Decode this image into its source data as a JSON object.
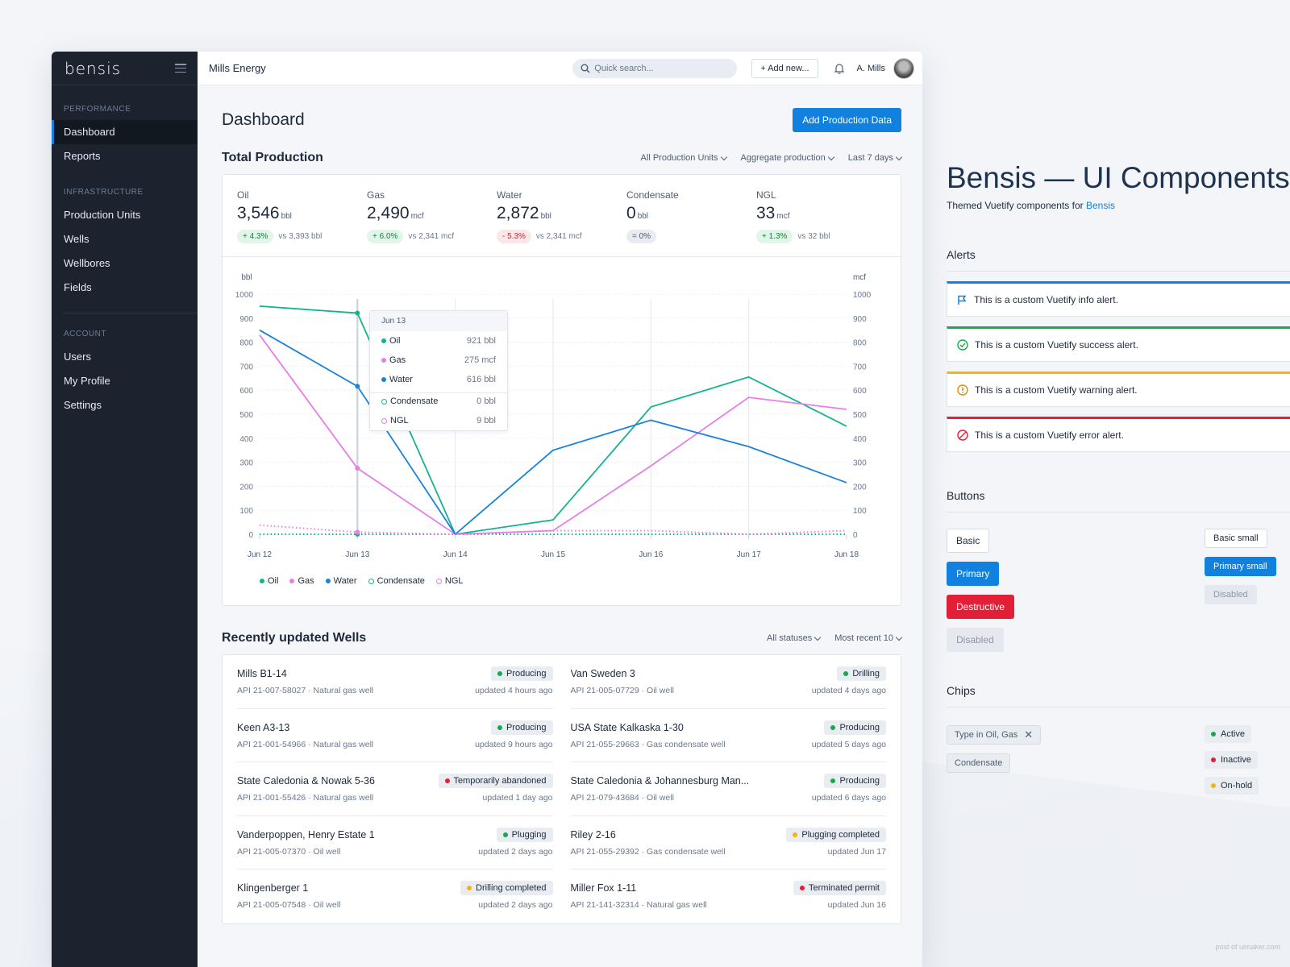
{
  "app": {
    "logo": "bensis",
    "org": "Mills Energy",
    "search_placeholder": "Quick search...",
    "add_new_label": "+ Add new...",
    "user_name": "A. Mills"
  },
  "sidebar": {
    "sections": [
      {
        "heading": "PERFORMANCE",
        "items": [
          {
            "label": "Dashboard",
            "active": true
          },
          {
            "label": "Reports"
          }
        ]
      },
      {
        "heading": "INFRASTRUCTURE",
        "items": [
          {
            "label": "Production Units"
          },
          {
            "label": "Wells"
          },
          {
            "label": "Wellbores"
          },
          {
            "label": "Fields"
          }
        ]
      },
      {
        "heading": "ACCOUNT",
        "items": [
          {
            "label": "Users"
          },
          {
            "label": "My Profile"
          },
          {
            "label": "Settings"
          }
        ]
      }
    ]
  },
  "page": {
    "title": "Dashboard",
    "primary_action": "Add Production Data"
  },
  "production": {
    "title": "Total Production",
    "filters": [
      "All Production Units",
      "Aggregate production",
      "Last 7 days"
    ],
    "stats": [
      {
        "label": "Oil",
        "value": "3,546",
        "unit": "bbl",
        "change": "+ 4.3%",
        "trend": "up",
        "compare": "vs 3,393 bbl"
      },
      {
        "label": "Gas",
        "value": "2,490",
        "unit": "mcf",
        "change": "+ 6.0%",
        "trend": "up",
        "compare": "vs 2,341 mcf"
      },
      {
        "label": "Water",
        "value": "2,872",
        "unit": "bbl",
        "change": "- 5.3%",
        "trend": "down",
        "compare": "vs 2,341 mcf"
      },
      {
        "label": "Condensate",
        "value": "0",
        "unit": "bbl",
        "change": "= 0%",
        "trend": "eq",
        "compare": ""
      },
      {
        "label": "NGL",
        "value": "33",
        "unit": "mcf",
        "change": "+ 1.3%",
        "trend": "up",
        "compare": "vs 32 bbl"
      }
    ],
    "tooltip": {
      "date": "Jun 13",
      "rows": [
        {
          "name": "Oil",
          "value": "921 bbl",
          "color": "#14b38f",
          "hollow": false
        },
        {
          "name": "Gas",
          "value": "275 mcf",
          "color": "#e67ee8",
          "hollow": false
        },
        {
          "name": "Water",
          "value": "616 bbl",
          "color": "#1a82d9",
          "hollow": false
        },
        {
          "name": "Condensate",
          "value": "0 bbl",
          "color": "#14b38f",
          "hollow": true
        },
        {
          "name": "NGL",
          "value": "9 bbl",
          "color": "#e67ee8",
          "hollow": true
        }
      ]
    }
  },
  "chart_data": {
    "type": "line",
    "title": "",
    "x": [
      "Jun 12",
      "Jun 13",
      "Jun 14",
      "Jun 15",
      "Jun 16",
      "Jun 17",
      "Jun 18"
    ],
    "ylabel": "bbl",
    "y2label": "mcf",
    "ylim": [
      0,
      1000
    ],
    "y2lim": [
      0,
      1000
    ],
    "yticks": [
      0,
      100,
      200,
      300,
      400,
      500,
      600,
      700,
      800,
      900,
      1000
    ],
    "grid": true,
    "highlight_x": "Jun 13",
    "legend_position": "bottom-left",
    "series": [
      {
        "name": "Oil",
        "color": "#14b38f",
        "style": "solid",
        "marker": "filled",
        "values": [
          950,
          921,
          0,
          60,
          530,
          655,
          450
        ]
      },
      {
        "name": "Gas",
        "color": "#e67ee8",
        "style": "solid",
        "marker": "filled",
        "values": [
          830,
          275,
          0,
          15,
          285,
          570,
          520
        ]
      },
      {
        "name": "Water",
        "color": "#1a82d9",
        "style": "solid",
        "marker": "filled",
        "values": [
          850,
          616,
          0,
          350,
          475,
          365,
          215
        ]
      },
      {
        "name": "Condensate",
        "color": "#14b38f",
        "style": "dotted",
        "marker": "hollow",
        "values": [
          0,
          0,
          0,
          0,
          0,
          0,
          0
        ]
      },
      {
        "name": "NGL",
        "color": "#e67ee8",
        "style": "dotted",
        "marker": "hollow",
        "values": [
          38,
          9,
          0,
          15,
          15,
          0,
          15
        ]
      }
    ]
  },
  "wells": {
    "title": "Recently updated Wells",
    "filters": [
      "All statuses",
      "Most recent 10"
    ],
    "items": [
      {
        "name": "Mills B1-14",
        "meta": "API 21-007-58027 · Natural gas well",
        "status": "Producing",
        "status_color": "#18a84d",
        "updated": "updated 4 hours ago"
      },
      {
        "name": "Van Sweden 3",
        "meta": "API 21-005-07729 · Oil well",
        "status": "Drilling",
        "status_color": "#18a84d",
        "updated": "updated 4 days ago"
      },
      {
        "name": "Keen A3-13",
        "meta": "API 21-001-54966 · Natural gas well",
        "status": "Producing",
        "status_color": "#18a84d",
        "updated": "updated 9 hours ago"
      },
      {
        "name": "USA State Kalkaska 1-30",
        "meta": "API 21-055-29663 · Gas condensate well",
        "status": "Producing",
        "status_color": "#18a84d",
        "updated": "updated 5 days ago"
      },
      {
        "name": "State Caledonia & Nowak 5-36",
        "meta": "API 21-001-55426 · Natural gas well",
        "status": "Temporarily abandoned",
        "status_color": "#e21f36",
        "updated": "updated 1 day ago"
      },
      {
        "name": "State Caledonia & Johannesburg Man...",
        "meta": "API 21-079-43684 · Oil well",
        "status": "Producing",
        "status_color": "#18a84d",
        "updated": "updated 6 days ago"
      },
      {
        "name": "Vanderpoppen, Henry Estate  1",
        "meta": "API 21-005-07370 · Oil well",
        "status": "Plugging",
        "status_color": "#18a84d",
        "updated": "updated 2 days ago"
      },
      {
        "name": "Riley 2-16",
        "meta": "API 21-055-29392 · Gas condensate well",
        "status": "Plugging completed",
        "status_color": "#f5b40a",
        "updated": "updated Jun 17"
      },
      {
        "name": "Klingenberger 1",
        "meta": "API 21-005-07548 · Oil well",
        "status": "Drilling completed",
        "status_color": "#f5b40a",
        "updated": "updated 2 days ago"
      },
      {
        "name": "Miller Fox 1-11",
        "meta": "API 21-141-32314 · Natural gas well",
        "status": "Terminated permit",
        "status_color": "#e21f36",
        "updated": "updated Jun 16"
      }
    ]
  },
  "components": {
    "title": "Bensis — UI Components",
    "subtitle_prefix": "Themed Vuetify components for ",
    "subtitle_link": "Bensis",
    "alerts_heading": "Alerts",
    "alerts": [
      {
        "type": "info",
        "icon": "flag-icon",
        "color": "#1081de",
        "text": "This is a custom Vuetify info alert."
      },
      {
        "type": "success",
        "icon": "check-circle-icon",
        "color": "#18a84d",
        "text": "This is a custom Vuetify success alert."
      },
      {
        "type": "warning",
        "icon": "exclamation-circle-icon",
        "color": "#f5b40a",
        "text": "This is a custom Vuetify warning alert."
      },
      {
        "type": "error",
        "icon": "prohibited-icon",
        "color": "#e21f36",
        "text": "This is a custom Vuetify error alert."
      }
    ],
    "buttons_heading": "Buttons",
    "buttons": {
      "basic": "Basic",
      "primary": "Primary",
      "destructive": "Destructive",
      "disabled": "Disabled",
      "basic_small": "Basic small",
      "primary_small": "Primary small",
      "disabled_small": "Disabled"
    },
    "chips_heading": "Chips",
    "chips": {
      "filter": "Type in Oil, Gas",
      "plain": "Condensate",
      "statuses": [
        {
          "label": "Active",
          "color": "#18a84d"
        },
        {
          "label": "Inactive",
          "color": "#e21f36"
        },
        {
          "label": "On-hold",
          "color": "#f5b40a"
        }
      ]
    }
  },
  "watermark": "post of uimaker.com"
}
